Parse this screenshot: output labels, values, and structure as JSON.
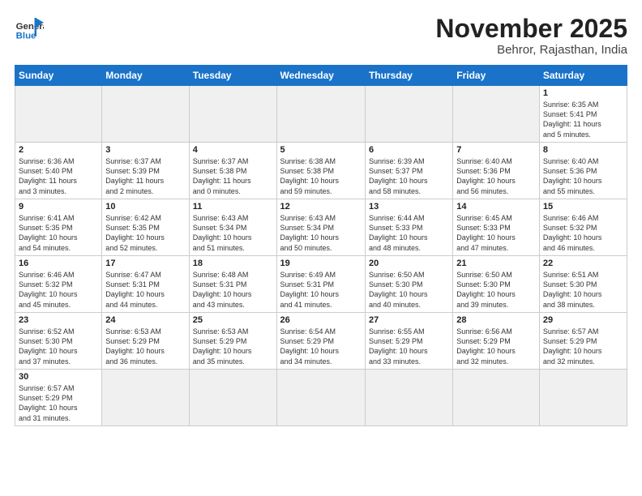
{
  "logo": {
    "line1": "General",
    "line2": "Blue"
  },
  "title": "November 2025",
  "location": "Behror, Rajasthan, India",
  "days_of_week": [
    "Sunday",
    "Monday",
    "Tuesday",
    "Wednesday",
    "Thursday",
    "Friday",
    "Saturday"
  ],
  "weeks": [
    [
      {
        "num": "",
        "info": ""
      },
      {
        "num": "",
        "info": ""
      },
      {
        "num": "",
        "info": ""
      },
      {
        "num": "",
        "info": ""
      },
      {
        "num": "",
        "info": ""
      },
      {
        "num": "",
        "info": ""
      },
      {
        "num": "1",
        "info": "Sunrise: 6:35 AM\nSunset: 5:41 PM\nDaylight: 11 hours\nand 5 minutes."
      }
    ],
    [
      {
        "num": "2",
        "info": "Sunrise: 6:36 AM\nSunset: 5:40 PM\nDaylight: 11 hours\nand 3 minutes."
      },
      {
        "num": "3",
        "info": "Sunrise: 6:37 AM\nSunset: 5:39 PM\nDaylight: 11 hours\nand 2 minutes."
      },
      {
        "num": "4",
        "info": "Sunrise: 6:37 AM\nSunset: 5:38 PM\nDaylight: 11 hours\nand 0 minutes."
      },
      {
        "num": "5",
        "info": "Sunrise: 6:38 AM\nSunset: 5:38 PM\nDaylight: 10 hours\nand 59 minutes."
      },
      {
        "num": "6",
        "info": "Sunrise: 6:39 AM\nSunset: 5:37 PM\nDaylight: 10 hours\nand 58 minutes."
      },
      {
        "num": "7",
        "info": "Sunrise: 6:40 AM\nSunset: 5:36 PM\nDaylight: 10 hours\nand 56 minutes."
      },
      {
        "num": "8",
        "info": "Sunrise: 6:40 AM\nSunset: 5:36 PM\nDaylight: 10 hours\nand 55 minutes."
      }
    ],
    [
      {
        "num": "9",
        "info": "Sunrise: 6:41 AM\nSunset: 5:35 PM\nDaylight: 10 hours\nand 54 minutes."
      },
      {
        "num": "10",
        "info": "Sunrise: 6:42 AM\nSunset: 5:35 PM\nDaylight: 10 hours\nand 52 minutes."
      },
      {
        "num": "11",
        "info": "Sunrise: 6:43 AM\nSunset: 5:34 PM\nDaylight: 10 hours\nand 51 minutes."
      },
      {
        "num": "12",
        "info": "Sunrise: 6:43 AM\nSunset: 5:34 PM\nDaylight: 10 hours\nand 50 minutes."
      },
      {
        "num": "13",
        "info": "Sunrise: 6:44 AM\nSunset: 5:33 PM\nDaylight: 10 hours\nand 48 minutes."
      },
      {
        "num": "14",
        "info": "Sunrise: 6:45 AM\nSunset: 5:33 PM\nDaylight: 10 hours\nand 47 minutes."
      },
      {
        "num": "15",
        "info": "Sunrise: 6:46 AM\nSunset: 5:32 PM\nDaylight: 10 hours\nand 46 minutes."
      }
    ],
    [
      {
        "num": "16",
        "info": "Sunrise: 6:46 AM\nSunset: 5:32 PM\nDaylight: 10 hours\nand 45 minutes."
      },
      {
        "num": "17",
        "info": "Sunrise: 6:47 AM\nSunset: 5:31 PM\nDaylight: 10 hours\nand 44 minutes."
      },
      {
        "num": "18",
        "info": "Sunrise: 6:48 AM\nSunset: 5:31 PM\nDaylight: 10 hours\nand 43 minutes."
      },
      {
        "num": "19",
        "info": "Sunrise: 6:49 AM\nSunset: 5:31 PM\nDaylight: 10 hours\nand 41 minutes."
      },
      {
        "num": "20",
        "info": "Sunrise: 6:50 AM\nSunset: 5:30 PM\nDaylight: 10 hours\nand 40 minutes."
      },
      {
        "num": "21",
        "info": "Sunrise: 6:50 AM\nSunset: 5:30 PM\nDaylight: 10 hours\nand 39 minutes."
      },
      {
        "num": "22",
        "info": "Sunrise: 6:51 AM\nSunset: 5:30 PM\nDaylight: 10 hours\nand 38 minutes."
      }
    ],
    [
      {
        "num": "23",
        "info": "Sunrise: 6:52 AM\nSunset: 5:30 PM\nDaylight: 10 hours\nand 37 minutes."
      },
      {
        "num": "24",
        "info": "Sunrise: 6:53 AM\nSunset: 5:29 PM\nDaylight: 10 hours\nand 36 minutes."
      },
      {
        "num": "25",
        "info": "Sunrise: 6:53 AM\nSunset: 5:29 PM\nDaylight: 10 hours\nand 35 minutes."
      },
      {
        "num": "26",
        "info": "Sunrise: 6:54 AM\nSunset: 5:29 PM\nDaylight: 10 hours\nand 34 minutes."
      },
      {
        "num": "27",
        "info": "Sunrise: 6:55 AM\nSunset: 5:29 PM\nDaylight: 10 hours\nand 33 minutes."
      },
      {
        "num": "28",
        "info": "Sunrise: 6:56 AM\nSunset: 5:29 PM\nDaylight: 10 hours\nand 32 minutes."
      },
      {
        "num": "29",
        "info": "Sunrise: 6:57 AM\nSunset: 5:29 PM\nDaylight: 10 hours\nand 32 minutes."
      }
    ],
    [
      {
        "num": "30",
        "info": "Sunrise: 6:57 AM\nSunset: 5:29 PM\nDaylight: 10 hours\nand 31 minutes."
      },
      {
        "num": "",
        "info": ""
      },
      {
        "num": "",
        "info": ""
      },
      {
        "num": "",
        "info": ""
      },
      {
        "num": "",
        "info": ""
      },
      {
        "num": "",
        "info": ""
      },
      {
        "num": "",
        "info": ""
      }
    ]
  ]
}
